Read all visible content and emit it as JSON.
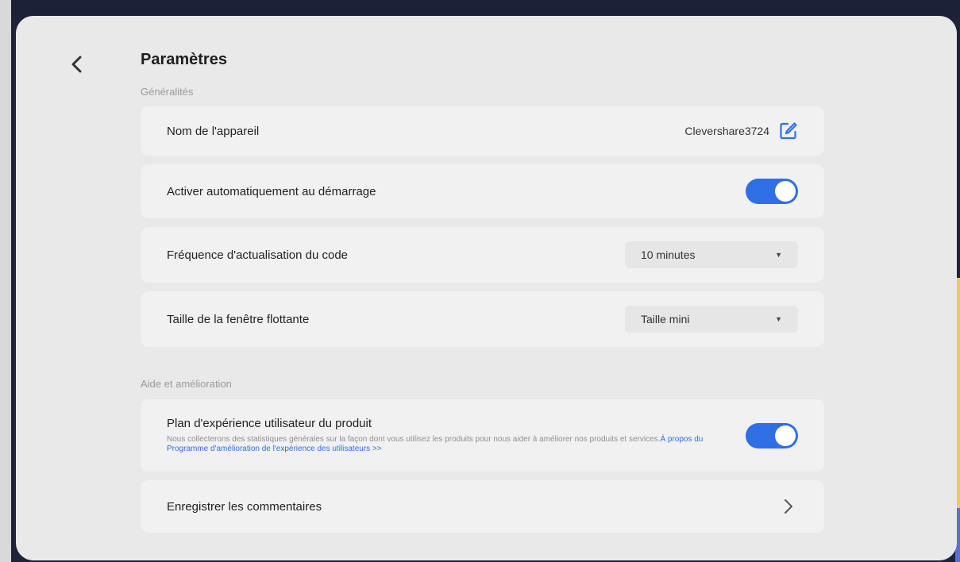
{
  "header": {
    "title": "Paramètres"
  },
  "sections": {
    "general": "Généralités",
    "help": "Aide et amélioration"
  },
  "general": {
    "device_name_label": "Nom de l'appareil",
    "device_name_value": "Clevershare3724",
    "auto_start_label": "Activer automatiquement au démarrage",
    "auto_start_on": true,
    "refresh_label": "Fréquence d'actualisation du code",
    "refresh_value": "10 minutes",
    "window_size_label": "Taille de la fenêtre flottante",
    "window_size_value": "Taille mini"
  },
  "help": {
    "plan_title": "Plan d'expérience utilisateur du produit",
    "plan_desc": "Nous collecterons des statistiques générales sur la façon dont vous utilisez les produits pour nous aider à améliorer nos produits et services.",
    "plan_link": "À propos du Programme d'amélioration de l'expérience des utilisateurs >>",
    "plan_on": true,
    "feedback_label": "Enregistrer les commentaires"
  },
  "icons": {
    "back": "chevron-left-icon",
    "edit": "edit-icon",
    "dropdown": "caret-down-icon",
    "forward": "chevron-right-icon"
  },
  "colors": {
    "accent": "#2f6fe6",
    "panel": "#e9e9ea",
    "card": "#f1f1f1"
  }
}
